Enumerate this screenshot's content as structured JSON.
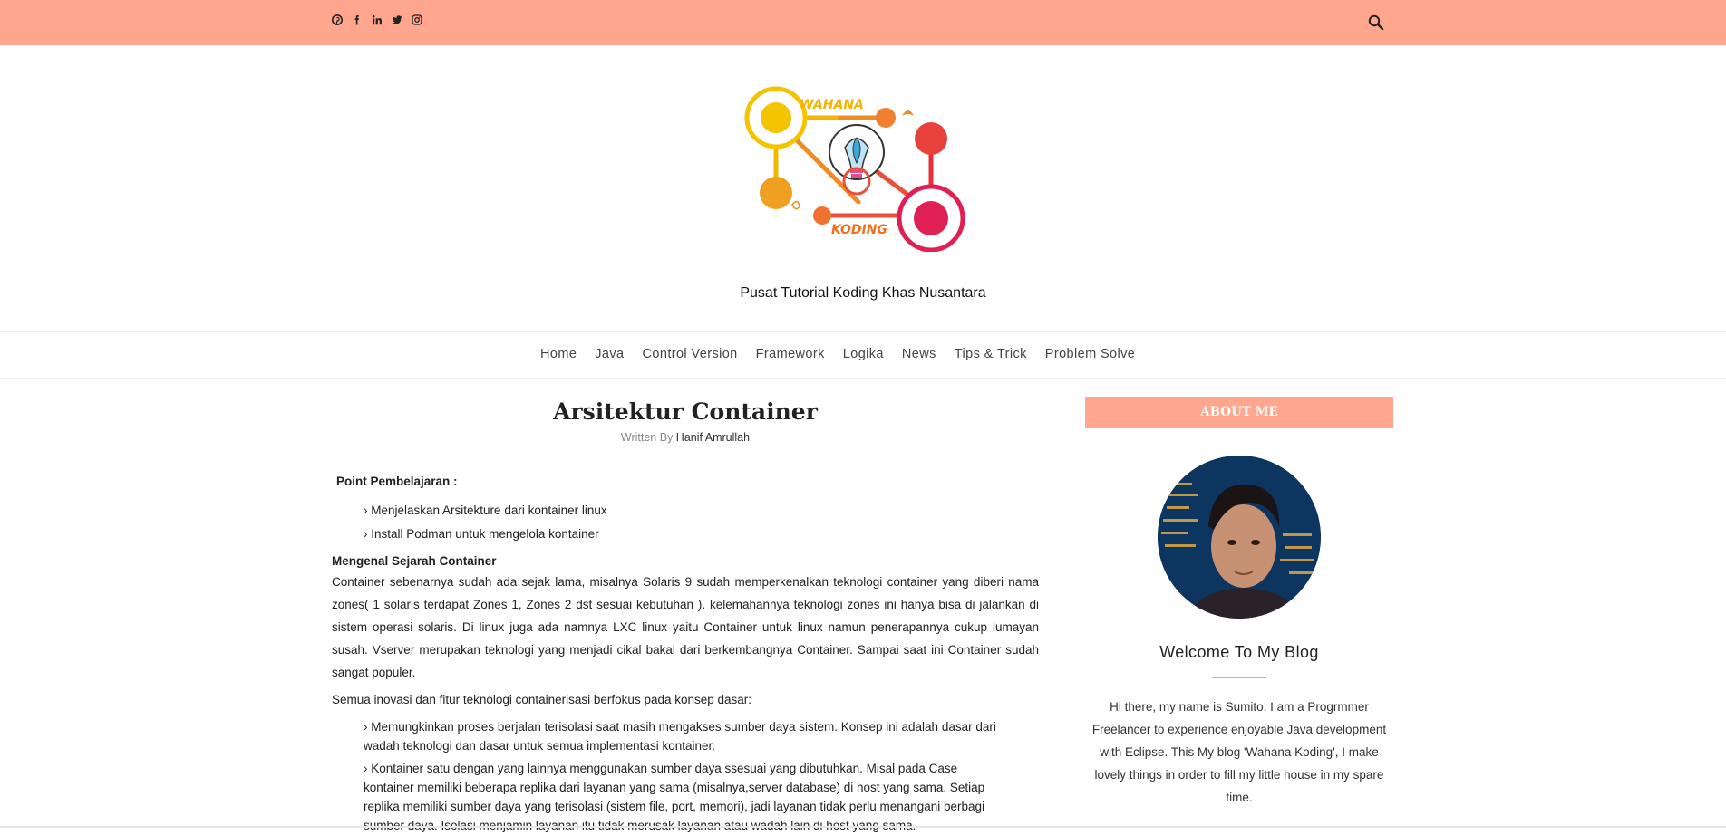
{
  "header": {
    "social_icons": [
      "pinterest-icon",
      "facebook-icon",
      "linkedin-icon",
      "twitter-icon",
      "instagram-icon"
    ],
    "search_icon": "search-icon",
    "logo_text_top": "WAHANA",
    "logo_text_bottom": "KODING"
  },
  "tagline": "Pusat Tutorial Koding Khas Nusantara",
  "nav": {
    "items": [
      {
        "label": "Home"
      },
      {
        "label": "Java"
      },
      {
        "label": "Control Version"
      },
      {
        "label": "Framework"
      },
      {
        "label": "Logika"
      },
      {
        "label": "News"
      },
      {
        "label": "Tips & Trick"
      },
      {
        "label": "Problem Solve"
      }
    ]
  },
  "post": {
    "title": "Arsitektur Container",
    "written_by": "Written By",
    "author": "Hanif Amrullah",
    "point_heading": "Point Pembelajaran  :",
    "points": [
      "› Menjelaskan Arsitekture dari kontainer linux",
      "› Install Podman untuk mengelola kontainer"
    ],
    "section_heading": "Mengenal Sejarah Container",
    "paragraph1": "Container sebenarnya sudah ada sejak lama, misalnya Solaris 9 sudah memperkenalkan teknologi container yang diberi nama zones( 1 solaris terdapat Zones 1, Zones 2 dst sesuai kebutuhan ). kelemahannya teknologi zones ini hanya bisa di jalankan di sistem operasi solaris. Di linux juga ada namnya LXC linux yaitu Container untuk linux namun penerapannya cukup lumayan susah.  Vserver merupakan teknologi yang menjadi cikal bakal dari berkembangnya  Container. Sampai saat ini Container sudah sangat populer.",
    "paragraph2": "Semua inovasi dan fitur teknologi containerisasi berfokus pada konsep dasar:",
    "concepts": [
      "› Memungkinkan proses berjalan terisolasi saat masih mengakses sumber daya sistem. Konsep ini adalah dasar dari wadah teknologi dan dasar untuk semua implementasi kontainer.",
      "›  Kontainer satu dengan yang lainnya menggunakan sumber daya ssesuai yang dibutuhkan. Misal pada Case kontainer memiliki beberapa replika dari layanan yang sama (misalnya,server database) di host yang sama. Setiap replika memiliki sumber daya yang terisolasi (sistem file, port, memori), jadi layanan tidak perlu menangani berbagi sumber daya. Isolasi menjamin layanan itu tidak merusak layanan atau wadah lain di host yang sama."
    ]
  },
  "sidebar": {
    "title": "ABOUT ME",
    "welcome": "Welcome To My Blog",
    "about": "Hi there, my name is Sumito. I am a Progrmmer Freelancer to experience enjoyable Java development with Eclipse. This My blog 'Wahana Koding', I make lovely things in order to fill my little house in my spare time."
  },
  "colors": {
    "accent": "#ffa68f"
  }
}
